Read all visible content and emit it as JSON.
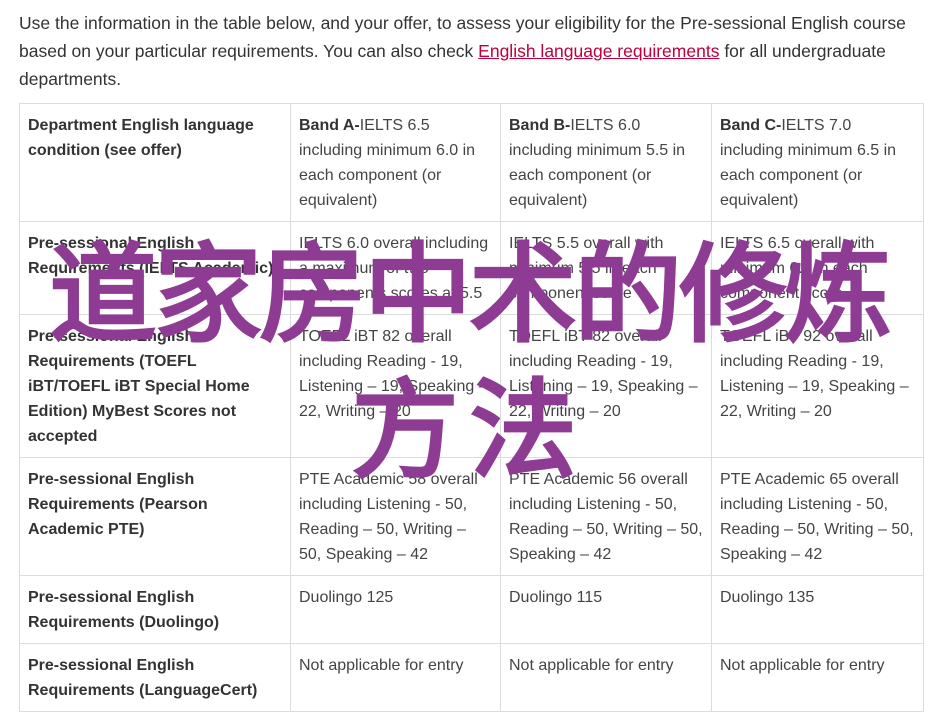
{
  "intro": {
    "text_before": "Use the information in the table below, and your offer, to assess your eligibility for the Pre-sessional English course based on your particular requirements. You can also check ",
    "link": "English language requirements",
    "text_after": " for all undergraduate departments."
  },
  "table": {
    "header": {
      "label": "Department English language condition (see offer)",
      "bands": [
        {
          "label": "Band A-",
          "text": "IELTS 6.5 including minimum 6.0 in each component (or equivalent)"
        },
        {
          "label": "Band B-",
          "text": "IELTS 6.0 including minimum 5.5 in each component (or equivalent)"
        },
        {
          "label": "Band C-",
          "text": "IELTS 7.0 including minimum 6.5 in each component (or equivalent)"
        }
      ]
    },
    "rows": [
      {
        "label": "Pre-sessional English Requirements (IELTS Academic)",
        "cells": [
          "IELTS 6.0 overall including a maximum of two components scores at 5.5",
          "IELTS 5.5 overall with minimum 5.5 in each component score",
          "IELTS 6.5 overall with minimum 6.0 in each component score"
        ]
      },
      {
        "label": "Pre-sessional English Requirements (TOEFL iBT/TOEFL iBT Special Home Edition) MyBest Scores not accepted",
        "cells": [
          "TOEFL iBT 82 overall including Reading - 19, Listening – 19, Speaking – 22, Writing – 20",
          "TOEFL iBT 82 overall including Reading - 19, Listening – 19, Speaking – 22, Writing – 20",
          "TOEFL iBT 92 overall including Reading - 19, Listening – 19, Speaking – 22, Writing – 20"
        ]
      },
      {
        "label": "Pre-sessional English Requirements (Pearson Academic PTE)",
        "cells": [
          "PTE Academic 58 overall including Listening - 50, Reading – 50, Writing – 50, Speaking – 42",
          "PTE Academic 56 overall including Listening - 50, Reading – 50, Writing – 50, Speaking – 42",
          "PTE Academic 65 overall including Listening - 50, Reading – 50, Writing – 50, Speaking – 42"
        ]
      },
      {
        "label": "Pre-sessional English Requirements (Duolingo)",
        "cells": [
          "Duolingo 125",
          "Duolingo 115",
          "Duolingo 135"
        ]
      },
      {
        "label": "Pre-sessional English Requirements (LanguageCert)",
        "cells": [
          "Not applicable for entry",
          "Not applicable for entry",
          "Not applicable for entry"
        ]
      }
    ]
  },
  "watermark": {
    "line1": "道家房中术的修炼",
    "line2": "方法"
  }
}
